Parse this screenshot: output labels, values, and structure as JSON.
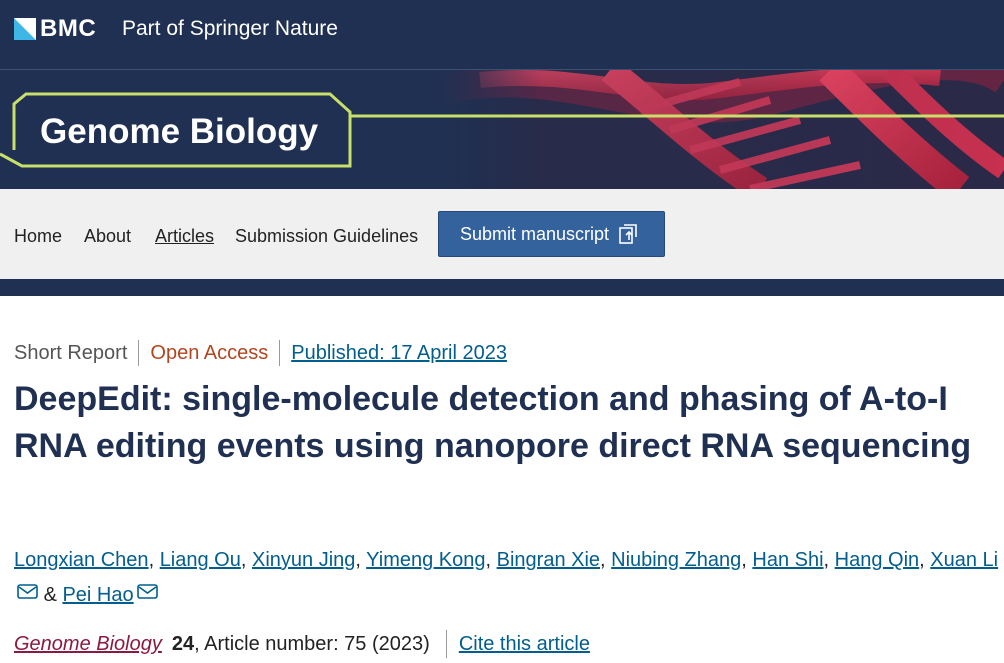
{
  "header": {
    "brand": "BMC",
    "tagline": "Part of Springer Nature"
  },
  "journal": {
    "title": "Genome Biology"
  },
  "nav": {
    "items": [
      {
        "label": "Home"
      },
      {
        "label": "About"
      },
      {
        "label": "Articles",
        "active": true
      },
      {
        "label": "Submission Guidelines"
      }
    ],
    "submit_label": "Submit manuscript"
  },
  "article": {
    "type": "Short Report",
    "access": "Open Access",
    "published": "Published: 17 April 2023",
    "title": "DeepEdit: single-molecule detection and phasing of A-to-I RNA editing events using nanopore direct RNA sequencing",
    "authors": [
      "Longxian Chen",
      "Liang Ou",
      "Xinyun Jing",
      "Yimeng Kong",
      "Bingran Xie",
      "Niubing Zhang",
      "Han Shi",
      "Hang Qin",
      "Xuan Li",
      "Pei Hao"
    ],
    "authors_connector": "&",
    "citation": {
      "journal": "Genome Biology",
      "volume": "24",
      "rest": ", Article number: 75 (2023)",
      "cite_label": "Cite this article"
    }
  },
  "colors": {
    "navy": "#1f3052",
    "accent_green": "#c8e06a",
    "link_blue": "#025e8d",
    "open_access_orange": "#b1461f",
    "button_blue": "#33629d"
  },
  "icons": [
    "bmc-logo-icon",
    "external-link-icon",
    "mail-icon"
  ]
}
